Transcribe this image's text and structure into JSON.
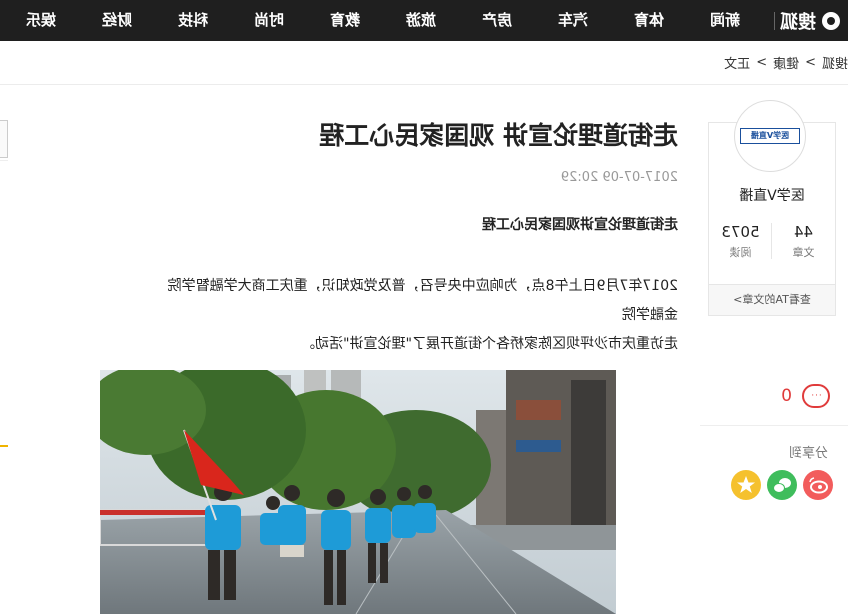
{
  "site": {
    "logo_text": "搜狐"
  },
  "nav": {
    "items": [
      "新闻",
      "体育",
      "汽车",
      "房产",
      "旅游",
      "教育",
      "时尚",
      "科技",
      "财经",
      "娱乐"
    ]
  },
  "breadcrumb": {
    "home": "搜狐",
    "sep1": ">",
    "section": "健康",
    "sep2": ">",
    "current": "正文"
  },
  "author_card": {
    "badge": "医学V直播",
    "name": "医学V直播",
    "articles_count": "44",
    "articles_label": "文章",
    "reads_count": "5073",
    "reads_label": "阅读",
    "more_link": "查看TA的文章>"
  },
  "comments": {
    "icon_text": "···",
    "count": "0"
  },
  "share": {
    "label": "分享到",
    "buttons": [
      "weibo",
      "wechat",
      "qzone"
    ]
  },
  "article": {
    "title": "走街道理论宣讲 观国家民心工程",
    "date": "2017-07-09 20:29",
    "subtitle": "走街道理论宣讲观国家民心工程",
    "paragraph_line1": "2017年7月9日上午8点，为响应中央号召，普及党政知识，重庆工商大学融智学院金融学院",
    "paragraph_line2": "走访重庆市沙坪坝区陈家桥各个街道开展了\"理论宣讲\"活动。"
  },
  "colors": {
    "topbar": "#1f1f1f",
    "accent_red": "#e03b3b",
    "shirt_blue": "#1e9bd7",
    "flag_red": "#d9261c"
  }
}
